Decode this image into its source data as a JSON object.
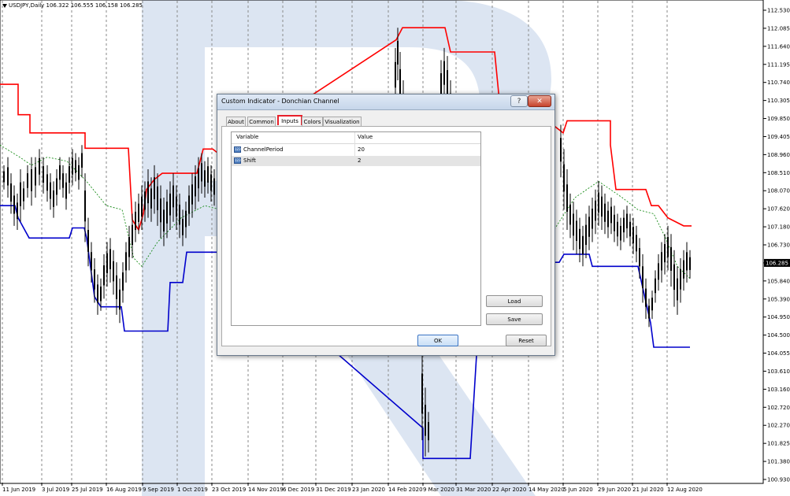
{
  "window": {
    "symbol_info": "USDJPY,Daily  106.322 106.555 106.158 106.285"
  },
  "colors": {
    "upper_band": "#ff0000",
    "lower_band": "#0000cc",
    "middle_band": "#008000",
    "candles": "#000000",
    "price_label_bg": "#000000"
  },
  "chart_data": {
    "type": "candlestick",
    "title": "",
    "symbol": "USDJPY",
    "timeframe": "Daily",
    "ohlc_current": {
      "open": 106.322,
      "high": 106.555,
      "low": 106.158,
      "close": 106.285
    },
    "current_price": "106.285",
    "ylim": [
      100.93,
      112.63
    ],
    "y_ticks": [
      "112.530",
      "112.085",
      "111.640",
      "111.195",
      "110.740",
      "110.305",
      "109.850",
      "109.405",
      "108.960",
      "108.510",
      "108.070",
      "107.620",
      "107.180",
      "106.730",
      "106.285",
      "105.840",
      "105.390",
      "104.950",
      "104.500",
      "104.055",
      "103.610",
      "103.160",
      "102.720",
      "102.270",
      "101.825",
      "101.380",
      "100.930"
    ],
    "x_ticks": [
      "11 Jun 2019",
      "3 Jul 2019",
      "25 Jul 2019",
      "16 Aug 2019",
      "9 Sep 2019",
      "1 Oct 2019",
      "23 Oct 2019",
      "14 Nov 2019",
      "6 Dec 2019",
      "31 Dec 2019",
      "23 Jan 2020",
      "14 Feb 2020",
      "9 Mar 2020",
      "31 Mar 2020",
      "22 Apr 2020",
      "14 May 2020",
      "5 Jun 2020",
      "29 Jun 2020",
      "21 Jul 2020",
      "12 Aug 2020"
    ],
    "grid": true,
    "series": [
      {
        "name": "",
        "kind": "upper",
        "values": [
          [
            0,
            110.7
          ],
          [
            19,
            110.7
          ],
          [
            23,
            110.7
          ],
          [
            23,
            109.95
          ],
          [
            38,
            109.95
          ],
          [
            38,
            109.5
          ],
          [
            88,
            109.5
          ],
          [
            108,
            109.5
          ],
          [
            108,
            109.12
          ],
          [
            163,
            109.12
          ],
          [
            168,
            107.35
          ],
          [
            176,
            107.1
          ],
          [
            182,
            107.5
          ],
          [
            186,
            108.1
          ],
          [
            196,
            108.35
          ],
          [
            206,
            108.5
          ],
          [
            216,
            108.5
          ],
          [
            236,
            108.5
          ],
          [
            250,
            108.5
          ],
          [
            258,
            109.1
          ],
          [
            264,
            109.1
          ],
          [
            270,
            109.1
          ],
          [
            280,
            108.95
          ],
          [
            503,
            111.8
          ],
          [
            511,
            112.1
          ],
          [
            565,
            112.1
          ],
          [
            572,
            111.5
          ],
          [
            628,
            111.5
          ],
          [
            634,
            110.3
          ],
          [
            640,
            110.3
          ],
          [
            662,
            110.3
          ],
          [
            715,
            109.5
          ],
          [
            720,
            109.8
          ],
          [
            775,
            109.8
          ],
          [
            775,
            109.2
          ],
          [
            782,
            108.1
          ],
          [
            820,
            108.1
          ],
          [
            827,
            107.7
          ],
          [
            836,
            107.7
          ],
          [
            848,
            107.4
          ],
          [
            868,
            107.2
          ],
          [
            878,
            107.2
          ]
        ]
      },
      {
        "name": "",
        "kind": "lower",
        "values": [
          [
            0,
            107.7
          ],
          [
            19,
            107.7
          ],
          [
            23,
            107.4
          ],
          [
            37,
            106.9
          ],
          [
            69,
            106.9
          ],
          [
            88,
            106.9
          ],
          [
            92,
            107.15
          ],
          [
            107,
            107.15
          ],
          [
            110,
            106.9
          ],
          [
            120,
            105.45
          ],
          [
            128,
            105.2
          ],
          [
            154,
            105.2
          ],
          [
            158,
            104.6
          ],
          [
            213,
            104.6
          ],
          [
            216,
            105.8
          ],
          [
            232,
            105.8
          ],
          [
            237,
            106.55
          ],
          [
            280,
            106.55
          ],
          [
            537,
            102.2
          ],
          [
            537,
            101.45
          ],
          [
            597,
            101.45
          ],
          [
            605,
            104.0
          ],
          [
            610,
            106.3
          ],
          [
            710,
            106.3
          ],
          [
            716,
            106.5
          ],
          [
            748,
            106.5
          ],
          [
            752,
            106.2
          ],
          [
            810,
            106.2
          ],
          [
            818,
            105.5
          ],
          [
            826,
            104.8
          ],
          [
            830,
            104.2
          ],
          [
            876,
            104.2
          ]
        ]
      },
      {
        "name": "",
        "kind": "middle",
        "values": [
          [
            0,
            109.2
          ],
          [
            25,
            108.9
          ],
          [
            40,
            108.7
          ],
          [
            60,
            108.9
          ],
          [
            85,
            108.8
          ],
          [
            100,
            108.5
          ],
          [
            110,
            108.3
          ],
          [
            135,
            107.7
          ],
          [
            155,
            107.6
          ],
          [
            170,
            106.4
          ],
          [
            180,
            106.2
          ],
          [
            200,
            106.8
          ],
          [
            230,
            107.4
          ],
          [
            260,
            107.7
          ],
          [
            280,
            107.6
          ],
          [
            700,
            107.0
          ],
          [
            730,
            107.9
          ],
          [
            760,
            108.3
          ],
          [
            790,
            107.9
          ],
          [
            810,
            107.6
          ],
          [
            830,
            107.5
          ],
          [
            845,
            106.9
          ],
          [
            860,
            106.2
          ],
          [
            876,
            105.9
          ]
        ]
      }
    ],
    "candles_note_free": true,
    "candle_points": [
      [
        5,
        108.7,
        108.1
      ],
      [
        10,
        108.9,
        107.9
      ],
      [
        14,
        108.5,
        107.5
      ],
      [
        18,
        108.2,
        107.2
      ],
      [
        22,
        108.0,
        107.1
      ],
      [
        26,
        108.6,
        107.3
      ],
      [
        30,
        108.3,
        107.6
      ],
      [
        35,
        108.7,
        107.9
      ],
      [
        40,
        108.9,
        107.7
      ],
      [
        45,
        108.9,
        107.9
      ],
      [
        50,
        109.1,
        108.2
      ],
      [
        55,
        108.9,
        108.0
      ],
      [
        60,
        108.7,
        107.8
      ],
      [
        64,
        108.5,
        107.6
      ],
      [
        68,
        108.3,
        107.4
      ],
      [
        72,
        108.6,
        107.7
      ],
      [
        76,
        108.9,
        108.1
      ],
      [
        80,
        108.7,
        107.9
      ],
      [
        84,
        108.5,
        107.6
      ],
      [
        88,
        108.9,
        108.0
      ],
      [
        92,
        109.1,
        108.2
      ],
      [
        96,
        109.0,
        108.3
      ],
      [
        100,
        108.9,
        108.1
      ],
      [
        104,
        109.2,
        108.4
      ],
      [
        108,
        108.5,
        106.8
      ],
      [
        112,
        107.4,
        106.2
      ],
      [
        116,
        106.8,
        105.8
      ],
      [
        120,
        106.4,
        105.3
      ],
      [
        124,
        106.0,
        105.0
      ],
      [
        128,
        105.9,
        105.1
      ],
      [
        132,
        106.5,
        105.4
      ],
      [
        136,
        106.8,
        105.7
      ],
      [
        140,
        106.9,
        105.8
      ],
      [
        144,
        106.6,
        105.5
      ],
      [
        148,
        106.3,
        105.0
      ],
      [
        152,
        105.9,
        104.8
      ],
      [
        156,
        106.3,
        105.3
      ],
      [
        160,
        106.8,
        105.8
      ],
      [
        164,
        107.2,
        106.1
      ],
      [
        168,
        107.5,
        106.4
      ],
      [
        172,
        107.8,
        106.8
      ],
      [
        176,
        108.0,
        107.0
      ],
      [
        180,
        108.2,
        107.1
      ],
      [
        184,
        108.3,
        107.3
      ],
      [
        188,
        108.6,
        107.4
      ],
      [
        192,
        108.4,
        107.3
      ],
      [
        196,
        108.7,
        107.5
      ],
      [
        200,
        108.5,
        107.2
      ],
      [
        204,
        108.2,
        106.9
      ],
      [
        208,
        107.9,
        106.7
      ],
      [
        212,
        108.1,
        106.9
      ],
      [
        216,
        108.3,
        107.1
      ],
      [
        220,
        108.5,
        107.3
      ],
      [
        224,
        108.2,
        107.1
      ],
      [
        228,
        108.0,
        106.9
      ],
      [
        232,
        107.6,
        106.7
      ],
      [
        236,
        107.8,
        106.9
      ],
      [
        240,
        108.2,
        107.2
      ],
      [
        244,
        108.5,
        107.4
      ],
      [
        248,
        108.7,
        107.6
      ],
      [
        252,
        108.9,
        107.8
      ],
      [
        256,
        109.0,
        108.0
      ],
      [
        260,
        108.8,
        107.9
      ],
      [
        264,
        108.9,
        108.0
      ],
      [
        268,
        108.7,
        107.8
      ],
      [
        272,
        108.6,
        107.7
      ],
      [
        502,
        111.6,
        110.2
      ],
      [
        505,
        112.1,
        110.8
      ],
      [
        508,
        111.5,
        109.8
      ],
      [
        512,
        110.8,
        109.2
      ],
      [
        516,
        110.2,
        108.9
      ],
      [
        560,
        111.3,
        110.0
      ],
      [
        564,
        111.6,
        110.3
      ],
      [
        568,
        111.4,
        110.0
      ],
      [
        572,
        110.8,
        109.5
      ],
      [
        536,
        104.1,
        101.9
      ],
      [
        540,
        103.2,
        101.5
      ],
      [
        544,
        102.6,
        101.6
      ],
      [
        712,
        109.7,
        108.4
      ],
      [
        716,
        109.1,
        107.6
      ],
      [
        720,
        108.6,
        107.1
      ],
      [
        724,
        108.0,
        106.9
      ],
      [
        728,
        107.8,
        106.6
      ],
      [
        732,
        107.6,
        106.5
      ],
      [
        736,
        107.4,
        106.3
      ],
      [
        740,
        107.2,
        106.2
      ],
      [
        744,
        107.5,
        106.4
      ],
      [
        748,
        107.7,
        106.6
      ],
      [
        752,
        107.9,
        106.8
      ],
      [
        756,
        108.1,
        107.0
      ],
      [
        760,
        108.3,
        107.2
      ],
      [
        764,
        108.2,
        107.1
      ],
      [
        768,
        108.0,
        107.0
      ],
      [
        772,
        107.8,
        106.9
      ],
      [
        776,
        107.9,
        107.0
      ],
      [
        780,
        107.7,
        106.8
      ],
      [
        784,
        107.5,
        106.7
      ],
      [
        788,
        107.4,
        106.6
      ],
      [
        792,
        107.6,
        106.8
      ],
      [
        796,
        107.7,
        106.9
      ],
      [
        800,
        107.5,
        106.7
      ],
      [
        804,
        107.4,
        106.5
      ],
      [
        808,
        107.2,
        106.3
      ],
      [
        812,
        106.9,
        105.9
      ],
      [
        816,
        106.5,
        105.3
      ],
      [
        820,
        105.9,
        104.9
      ],
      [
        824,
        105.4,
        104.7
      ],
      [
        828,
        105.6,
        104.9
      ],
      [
        832,
        106.1,
        105.3
      ],
      [
        836,
        106.5,
        105.6
      ],
      [
        840,
        106.8,
        105.8
      ],
      [
        844,
        107.0,
        106.0
      ],
      [
        848,
        107.2,
        106.1
      ],
      [
        852,
        107.0,
        105.7
      ],
      [
        856,
        106.6,
        105.2
      ],
      [
        860,
        106.2,
        105.0
      ],
      [
        864,
        106.4,
        105.3
      ],
      [
        868,
        106.6,
        105.6
      ],
      [
        872,
        106.8,
        105.8
      ],
      [
        876,
        106.6,
        105.9
      ]
    ]
  },
  "dialog": {
    "title": "Custom Indicator - Donchian Channel",
    "help_label": "?",
    "close_label": "✕",
    "tabs": [
      {
        "label": "About"
      },
      {
        "label": "Common"
      },
      {
        "label": "Inputs"
      },
      {
        "label": "Colors"
      },
      {
        "label": "Visualization"
      }
    ],
    "active_tab": "Inputs",
    "table": {
      "col_variable": "Variable",
      "col_value": "Value",
      "rows": [
        {
          "icon": "param-icon",
          "name": "ChannelPeriod",
          "value": "20"
        },
        {
          "icon": "param-icon",
          "name": "Shift",
          "value": "2"
        }
      ]
    },
    "buttons": {
      "load": "Load",
      "save": "Save",
      "ok": "OK",
      "reset": "Reset"
    }
  },
  "icons": {
    "param_icon_text": "123"
  }
}
